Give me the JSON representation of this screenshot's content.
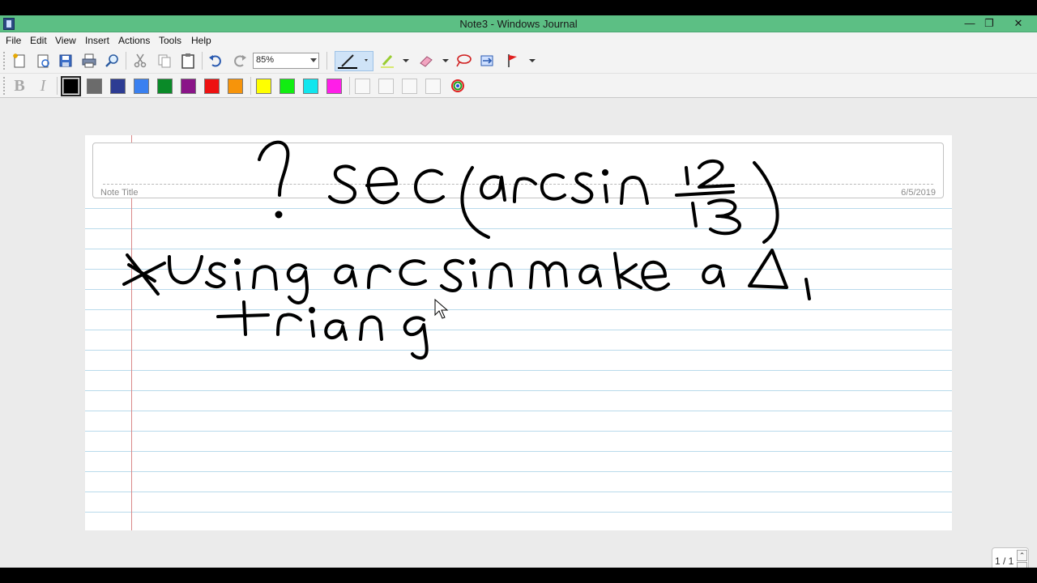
{
  "window": {
    "title": "Note3 - Windows Journal",
    "minimize_glyph": "—",
    "restore_glyph": "❐",
    "close_glyph": "✕"
  },
  "menu": {
    "items": [
      "File",
      "Edit",
      "View",
      "Insert",
      "Actions",
      "Tools",
      "Help"
    ]
  },
  "toolbar": {
    "zoom": "85%",
    "format_bold_glyph": "B",
    "format_italic_glyph": "I"
  },
  "palette": {
    "colors": [
      "#000000",
      "#6b6b6b",
      "#2d3c93",
      "#3a80f0",
      "#0a8a28",
      "#8a1488",
      "#ee1111",
      "#f7940a",
      "#ffff00",
      "#11ee11",
      "#11e6ee",
      "#ff1ee8"
    ],
    "selected": "#000000"
  },
  "note": {
    "title_label": "Note Title",
    "date": "6/5/2019",
    "ink_text": "? sec(arcsin 12/13) *Using arcsin make a Δ, triang"
  },
  "pager": {
    "text": "1 / 1",
    "up_glyph": "⌃",
    "down_glyph": "⌄"
  }
}
